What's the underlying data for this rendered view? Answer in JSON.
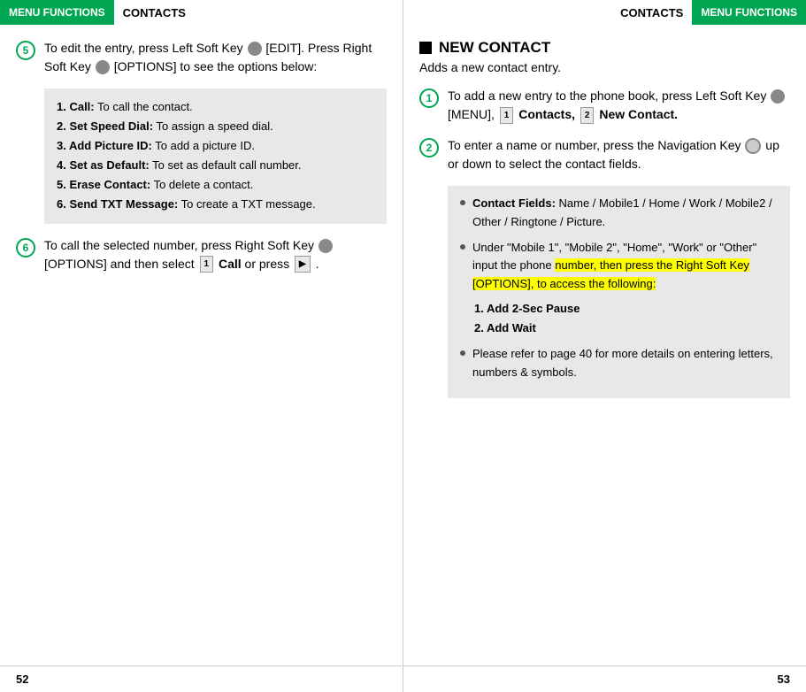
{
  "left": {
    "header": {
      "menu_functions": "MENU FUNCTIONS",
      "contacts": "CONTACTS"
    },
    "step5": {
      "circle": "5",
      "text_before": "To edit the entry, press Left Soft Key",
      "edit_label": "[EDIT]. Press Right Soft Key",
      "options_label": "[OPTIONS] to see the options below:"
    },
    "options": [
      {
        "label": "1. Call:",
        "desc": " To call the contact."
      },
      {
        "label": "2. Set Speed Dial:",
        "desc": " To assign a speed dial."
      },
      {
        "label": "3. Add Picture ID:",
        "desc": " To add a picture ID."
      },
      {
        "label": "4. Set as Default:",
        "desc": " To set as default call number."
      },
      {
        "label": "5. Erase Contact:",
        "desc": " To delete a contact."
      },
      {
        "label": "6. Send TXT Message:",
        "desc": " To create a TXT message."
      }
    ],
    "step6": {
      "circle": "6",
      "text": "To call the selected number, press Right Soft Key",
      "options_text": "[OPTIONS] and then select",
      "badge1": "1",
      "call_text": "Call or press",
      "end_symbol": "."
    },
    "footer_page": "52"
  },
  "right": {
    "header": {
      "contacts": "CONTACTS",
      "menu_functions": "MENU FUNCTIONS"
    },
    "section_title": "NEW CONTACT",
    "section_subtitle": "Adds a new contact entry.",
    "step1": {
      "circle": "1",
      "text": "To add a new entry to the phone book, press Left Soft Key",
      "menu_label": "[MENU],",
      "badge1": "1",
      "contacts_text": "Contacts,",
      "badge2": "2",
      "new_contact_text": "New Contact."
    },
    "step2": {
      "circle": "2",
      "text": "To enter a name or number, press the Navigation Key",
      "nav_text": "up or down to select the contact fields."
    },
    "bullets": [
      {
        "label": "Contact Fields:",
        "text": " Name / Mobile1 / Home / Work / Mobile2 / Other / Ringtone / Picture."
      },
      {
        "label": "Under \"Mobile 1\", \"Mobile 2\", \"Home\", \"Work\" or \"Other\" input the phone ",
        "highlighted": "number, then press the Right Soft Key",
        "highlight_icon": true,
        "after_highlight": "[OPTIONS], to access the following:",
        "numbered": [
          "1. Add 2-Sec Pause",
          "2. Add Wait"
        ]
      },
      {
        "label": "Please refer to page 40 for more details on entering letters, numbers & symbols."
      }
    ],
    "footer_page": "53"
  }
}
